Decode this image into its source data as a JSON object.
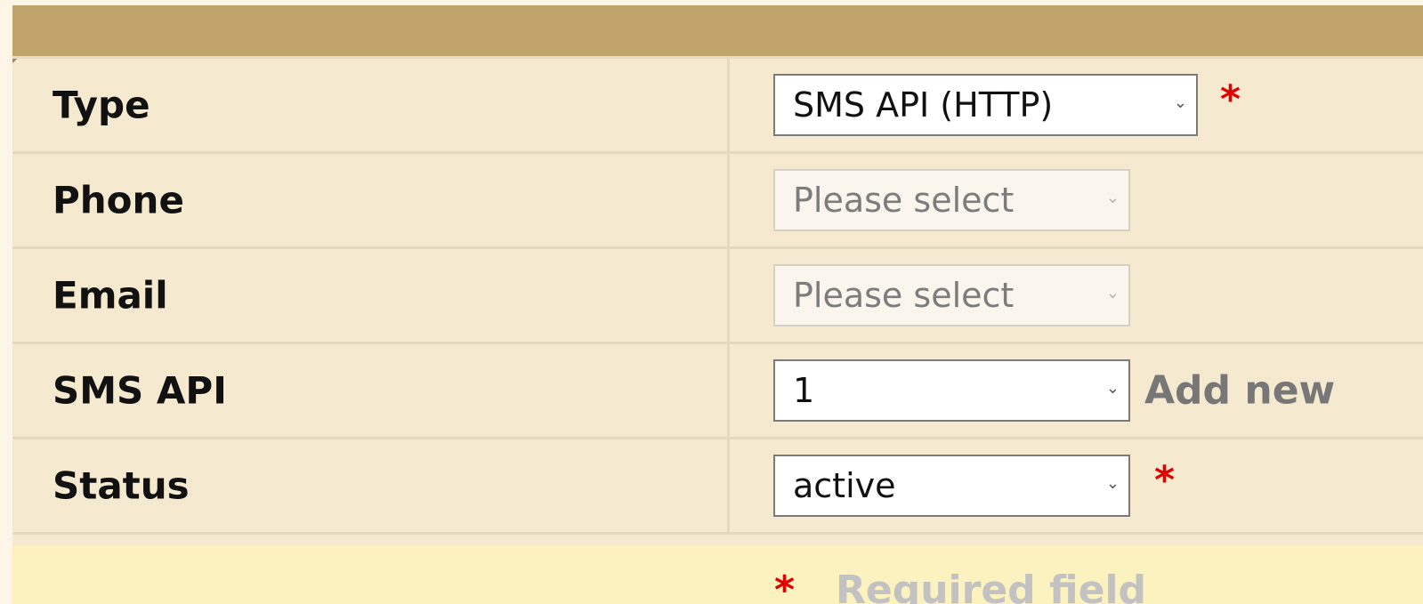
{
  "form": {
    "rows": [
      {
        "label": "Type",
        "select_value": "SMS API (HTTP)",
        "disabled": false,
        "required": true
      },
      {
        "label": "Phone",
        "select_value": "Please select",
        "disabled": true,
        "required": false
      },
      {
        "label": "Email",
        "select_value": "Please select",
        "disabled": true,
        "required": false
      },
      {
        "label": "SMS API",
        "select_value": "1",
        "disabled": false,
        "required": false,
        "action_label": "Add new"
      },
      {
        "label": "Status",
        "select_value": "active",
        "disabled": false,
        "required": true
      }
    ],
    "required_marker": "*",
    "footer_note": "Required field"
  },
  "icons": {
    "select_arrow": "chevron-down-icon",
    "required": "asterisk-icon"
  },
  "colors": {
    "header_bar": "#bfa36b",
    "form_background": "#f5e9d0",
    "required_star": "#e00000",
    "footer_background": "#fcf2c0"
  }
}
